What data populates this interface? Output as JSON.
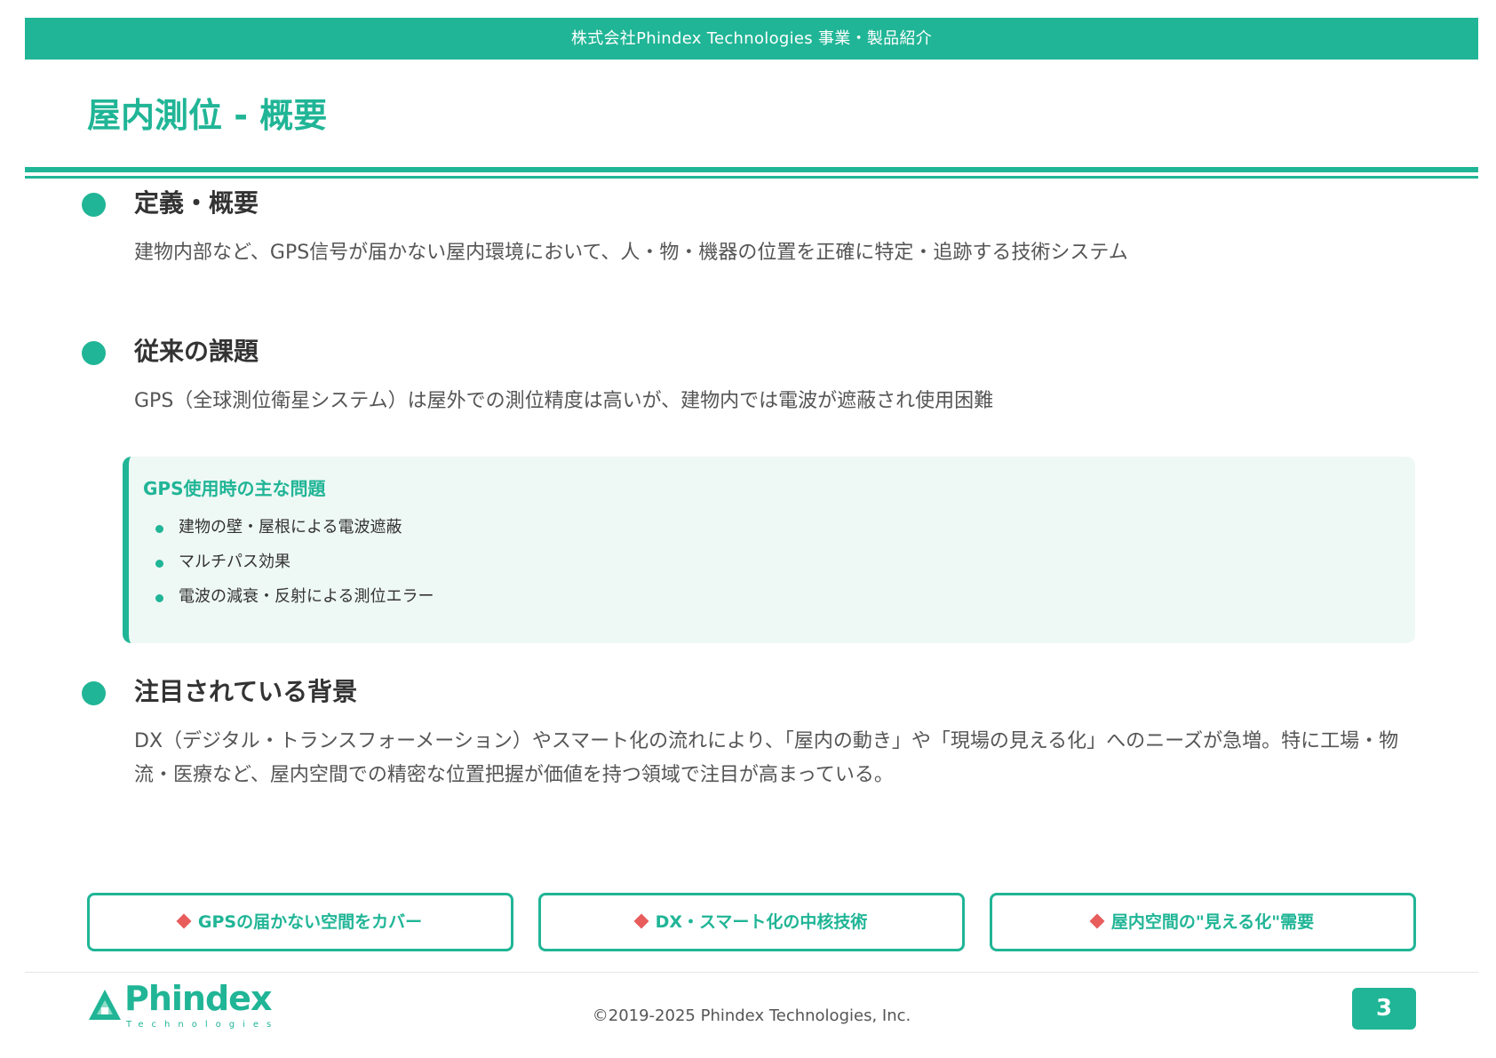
{
  "header": {
    "banner": "株式会社Phindex Technologies 事業・製品紹介"
  },
  "page": {
    "title": "屋内測位 - 概要"
  },
  "sections": [
    {
      "heading": "定義・概要",
      "body": "建物内部など、GPS信号が届かない屋内環境において、人・物・機器の位置を正確に特定・追跡する技術システム"
    },
    {
      "heading": "従来の課題",
      "body": "GPS（全球測位衛星システム）は屋外での測位精度は高いが、建物内では電波が遮蔽され使用困難"
    },
    {
      "heading": "注目されている背景",
      "body": "DX（デジタル・トランスフォーメーション）やスマート化の流れにより、「屋内の動き」や「現場の見える化」へのニーズが急増。特に工場・物流・医療など、屋内空間での精密な位置把握が価値を持つ領域で注目が高まっている。"
    }
  ],
  "problem_box": {
    "title": "GPS使用時の主な問題",
    "items": [
      "建物の壁・屋根による電波遮蔽",
      "マルチパス効果",
      "電波の減衰・反射による測位エラー"
    ]
  },
  "features": [
    "GPSの届かない空間をカバー",
    "DX・スマート化の中核技術",
    "屋内空間の\"見える化\"需要"
  ],
  "footer": {
    "logo_text": "Phindex",
    "logo_subtext": "Technologies",
    "copyright": "©2019-2025 Phindex Technologies, Inc.",
    "page_number": "3"
  },
  "colors": {
    "accent": "#20b596",
    "box_background": "#eef8f5",
    "diamond": "#e85c5c",
    "heading_text": "#333333",
    "body_text": "#555555"
  }
}
